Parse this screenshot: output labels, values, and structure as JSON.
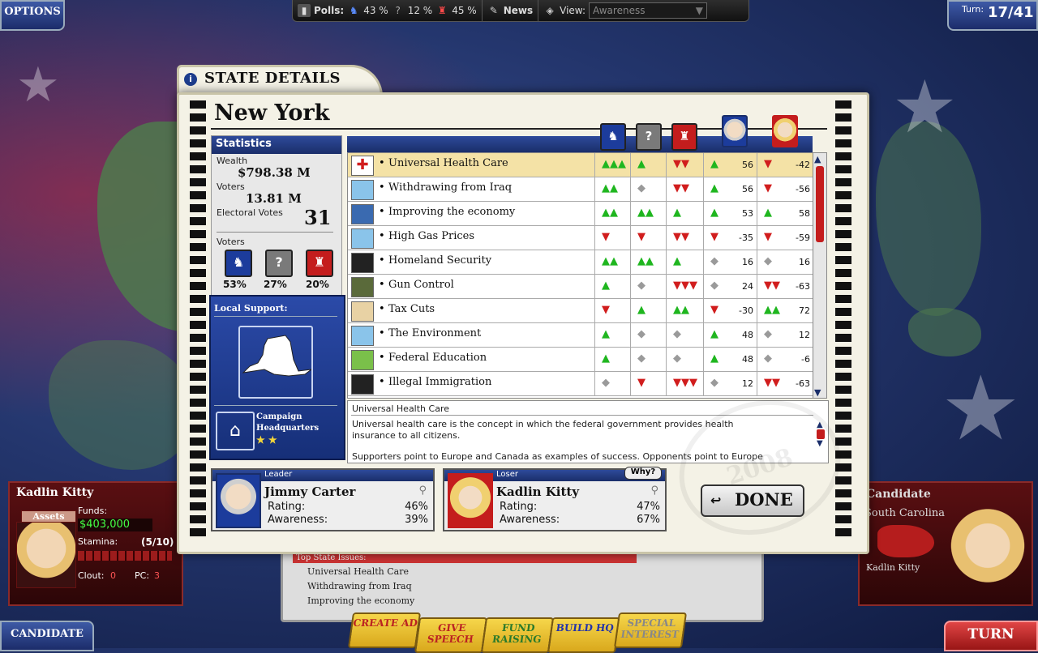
{
  "topbar": {
    "options_label": "OPTIONS",
    "polls_label": "Polls:",
    "dem_pct": "43 %",
    "und_pct": "12 %",
    "rep_pct": "45 %",
    "news_label": "News",
    "view_label": "View:",
    "view_value": "Awareness",
    "turn_label": "Turn:",
    "turn_value": "17/41"
  },
  "dialog": {
    "tab_title": "STATE DETAILS",
    "state_name": "New York",
    "stats": {
      "heading": "Statistics",
      "wealth_label": "Wealth",
      "wealth_value": "$798.38 M",
      "voters_label": "Voters",
      "voters_value": "13.81 M",
      "electoral_label": "Electoral Votes",
      "electoral_value": "31",
      "voters2_label": "Voters",
      "dem_pct": "53%",
      "und_pct": "27%",
      "rep_pct": "20%"
    },
    "local_support": {
      "heading": "Local Support:",
      "hq_label_1": "Campaign",
      "hq_label_2": "Headquarters",
      "stars": "★ ★"
    },
    "issues": [
      {
        "label": "Universal Health Care",
        "icon": "red-cross-icon",
        "dem": "up3",
        "und": "up1",
        "rep": "down2",
        "a": "up1",
        "a_val": "56",
        "b": "down1",
        "b_val": "-42",
        "selected": true
      },
      {
        "label": "Withdrawing from Iraq",
        "icon": "landscape-icon",
        "dem": "up2",
        "und": "neutral",
        "rep": "down2",
        "a": "up1",
        "a_val": "56",
        "b": "down1",
        "b_val": "-56",
        "selected": false
      },
      {
        "label": "Improving the economy",
        "icon": "money-icon",
        "dem": "up2",
        "und": "up2",
        "rep": "up1",
        "a": "up1",
        "a_val": "53",
        "b": "up1",
        "b_val": "58",
        "selected": false
      },
      {
        "label": "High Gas Prices",
        "icon": "landscape-icon",
        "dem": "down1",
        "und": "down1",
        "rep": "down2",
        "a": "down1",
        "a_val": "-35",
        "b": "down1",
        "b_val": "-59",
        "selected": false
      },
      {
        "label": "Homeland Security",
        "icon": "eagle-icon",
        "dem": "up2",
        "und": "up2",
        "rep": "up1",
        "a": "neutral",
        "a_val": "16",
        "b": "neutral",
        "b_val": "16",
        "selected": false
      },
      {
        "label": "Gun Control",
        "icon": "gun-icon",
        "dem": "up1",
        "und": "neutral",
        "rep": "down3",
        "a": "neutral",
        "a_val": "24",
        "b": "down2",
        "b_val": "-63",
        "selected": false
      },
      {
        "label": "Tax Cuts",
        "icon": "person-icon",
        "dem": "down1",
        "und": "up1",
        "rep": "up2",
        "a": "down1",
        "a_val": "-30",
        "b": "up2",
        "b_val": "72",
        "selected": false
      },
      {
        "label": "The Environment",
        "icon": "landscape-icon",
        "dem": "up1",
        "und": "neutral",
        "rep": "neutral",
        "a": "up1",
        "a_val": "48",
        "b": "neutral",
        "b_val": "12",
        "selected": false
      },
      {
        "label": "Federal Education",
        "icon": "bus-icon",
        "dem": "up1",
        "und": "neutral",
        "rep": "neutral",
        "a": "up1",
        "a_val": "48",
        "b": "neutral",
        "b_val": "-6",
        "selected": false
      },
      {
        "label": "Illegal Immigration",
        "icon": "eagle-icon",
        "dem": "neutral",
        "und": "down1",
        "rep": "down3",
        "a": "neutral",
        "a_val": "12",
        "b": "down2",
        "b_val": "-63",
        "selected": false
      }
    ],
    "description": {
      "title": "Universal Health Care",
      "para1": "Universal health care is the concept in which the federal government provides health insurance to all citizens.",
      "para2": "Supporters point to Europe and Canada as examples of success.  Opponents point to Europe"
    },
    "leader": {
      "head": "Leader",
      "name": "Jimmy Carter",
      "rating_label": "Rating:",
      "rating": "46%",
      "awareness_label": "Awareness:",
      "awareness": "39%"
    },
    "loser": {
      "head": "Loser",
      "why": "Why?",
      "name": "Kadlin Kitty",
      "rating_label": "Rating:",
      "rating": "47%",
      "awareness_label": "Awareness:",
      "awareness": "67%"
    },
    "done_label": "DONE"
  },
  "left_panel": {
    "name": "Kadlin Kitty",
    "assets_label": "Assets",
    "funds_label": "Funds:",
    "funds_value": "$403,000",
    "stamina_label": "Stamina:",
    "stamina_value": "(5/10)",
    "clout_label": "Clout:",
    "clout_value": "0",
    "pc_label": "PC:",
    "pc_value": "3",
    "candidate_button": "CANDIDATE"
  },
  "right_panel": {
    "heading": "Candidate",
    "state": "South Carolina",
    "name": "Kadlin Kitty",
    "turn_button": "TURN"
  },
  "bottom": {
    "heading": "Top State Issues:",
    "issues": [
      "Universal Health Care",
      "Withdrawing from Iraq",
      "Improving the economy"
    ],
    "tabs": [
      "CREATE AD",
      "GIVE SPEECH",
      "FUND RAISING",
      "BUILD HQ",
      "SPECIAL INTEREST"
    ]
  },
  "colors": {
    "dem_blue": "#1c3c9c",
    "rep_red": "#c41d1d",
    "undecided_gray": "#7a7a7a",
    "thumb_up_green": "#1fb61f",
    "thumb_down_red": "#d11d1d",
    "header_blue": "#1a2e6a",
    "selected_row": "#f4e2a6"
  }
}
